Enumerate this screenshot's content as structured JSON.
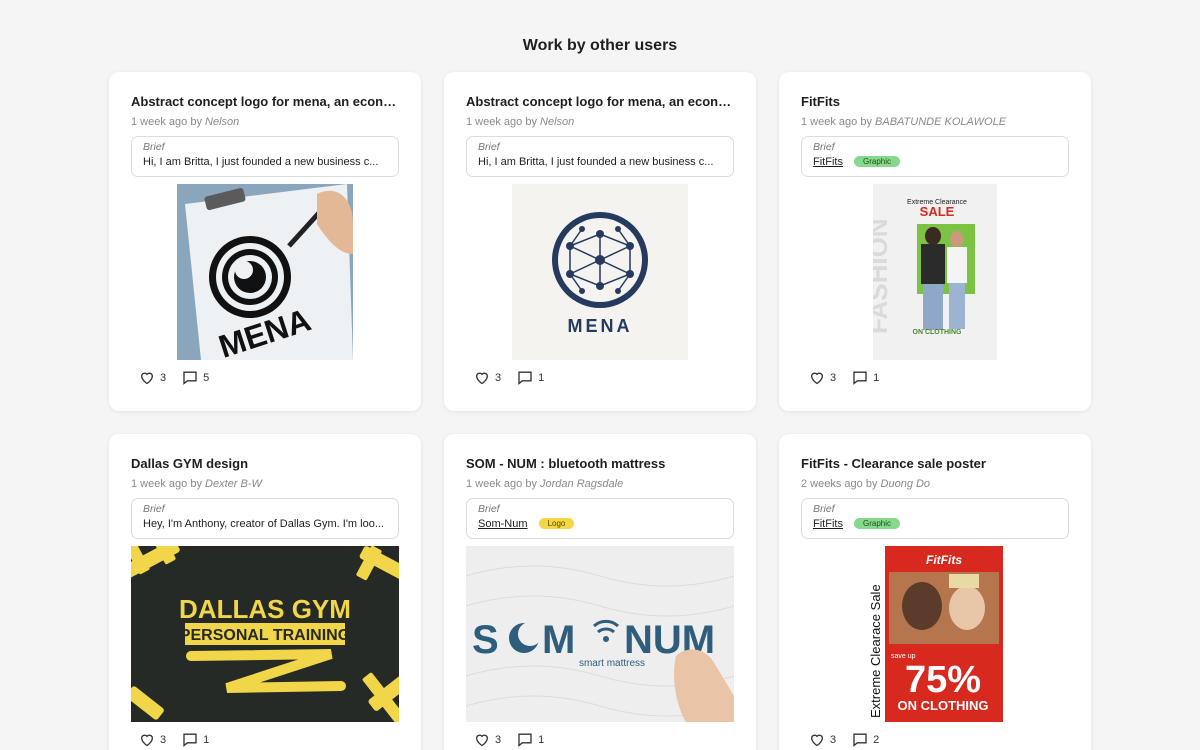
{
  "section_title": "Work by other users",
  "brief_label": "Brief",
  "meta_sep": "by",
  "cards": [
    {
      "title": "Abstract concept logo for mena, an econo...",
      "time": "1 week ago",
      "author": "Nelson",
      "brief_text": "Hi, I am Britta, I just founded a new business c...",
      "likes": "3",
      "comments": "5",
      "image_text": [
        "MENA"
      ]
    },
    {
      "title": "Abstract concept logo for mena, an econo...",
      "time": "1 week ago",
      "author": "Nelson",
      "brief_text": "Hi, I am Britta, I just founded a new business c...",
      "likes": "3",
      "comments": "1",
      "image_text": [
        "MENA"
      ]
    },
    {
      "title": "FitFits",
      "time": "1 week ago",
      "author": "BABATUNDE KOLAWOLE",
      "brief_link": "FitFits",
      "brief_tag": "Graphic",
      "likes": "3",
      "comments": "1",
      "image_text": [
        "Extreme Clearance",
        "SALE",
        "ON CLOTHING"
      ]
    },
    {
      "title": "Dallas GYM design",
      "time": "1 week ago",
      "author": "Dexter B-W",
      "brief_text": "Hey, I'm Anthony, creator of Dallas Gym. I'm loo...",
      "likes": "3",
      "comments": "1",
      "image_text": [
        "DALLAS GYM",
        "PERSONAL TRAINING"
      ]
    },
    {
      "title": "SOM - NUM : bluetooth mattress",
      "time": "1 week ago",
      "author": "Jordan Ragsdale",
      "brief_link": "Som-Num",
      "brief_tag": "Logo",
      "likes": "3",
      "comments": "1",
      "image_text": [
        "S",
        "M",
        "NUM",
        "smart mattress"
      ]
    },
    {
      "title": "FitFits - Clearance sale poster",
      "time": "2 weeks ago",
      "author": "Duong Do",
      "brief_link": "FitFits",
      "brief_tag": "Graphic",
      "likes": "3",
      "comments": "2",
      "image_text": [
        "FitFits",
        "Extreme Clearace Sale",
        "save up",
        "75%",
        "ON CLOTHING"
      ]
    }
  ],
  "colors": {
    "page_bg": "#f5f5f5",
    "card_bg": "#ffffff",
    "tag_graphic": "#86d88b",
    "tag_logo": "#f4d742",
    "mena_navy": "#253a5e",
    "gym_yellow": "#f1d64a",
    "somnum_blue": "#2e5d7d",
    "fitfits_red": "#d8291f",
    "fitfits_green": "#7cc243"
  },
  "icons": [
    "heart-icon",
    "comment-icon"
  ]
}
